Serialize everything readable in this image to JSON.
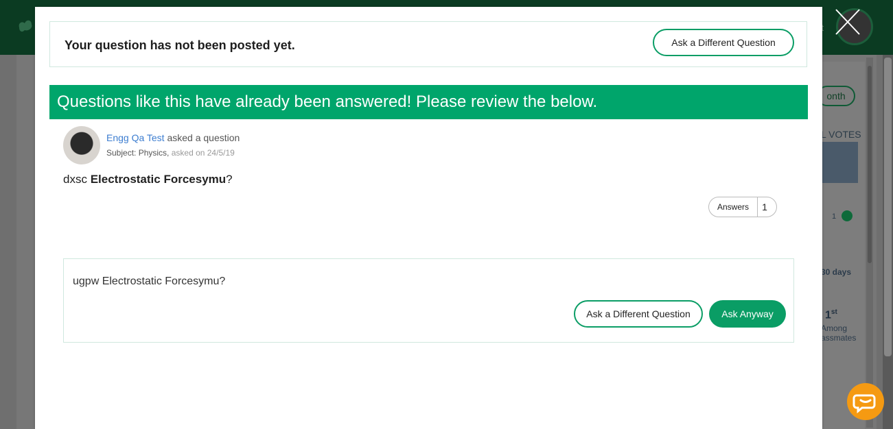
{
  "modal": {
    "notice_text": "Your question has not been posted yet.",
    "top_button": "Ask a Different Question",
    "banner_text": "Questions like this have already been answered! Please review the below.",
    "question": {
      "author": "Engg Qa Test",
      "action": "asked a question",
      "subject_label": "Subject: Physics,",
      "asked_on": "asked on 24/5/19",
      "text_prefix": "dxsc ",
      "text_bold": "Electrostatic Forcesymu",
      "text_suffix": "?",
      "answers_label": "Answers",
      "answers_count": "1"
    },
    "compose": {
      "text": "ugpw Electrostatic Forcesymu?",
      "different_button": "Ask a Different Question",
      "ask_button": "Ask Anyway"
    }
  },
  "background": {
    "user_fragment": "st",
    "month_label": "onth",
    "votes_label": "L VOTES",
    "votes_count": "1",
    "days_label": "30 days",
    "rank": "1",
    "rank_suffix": "st",
    "among_label": "Among",
    "classmates_label": "assmates"
  },
  "colors": {
    "accent": "#00a56b",
    "link": "#3c7dd0",
    "chat": "#f59a12"
  }
}
